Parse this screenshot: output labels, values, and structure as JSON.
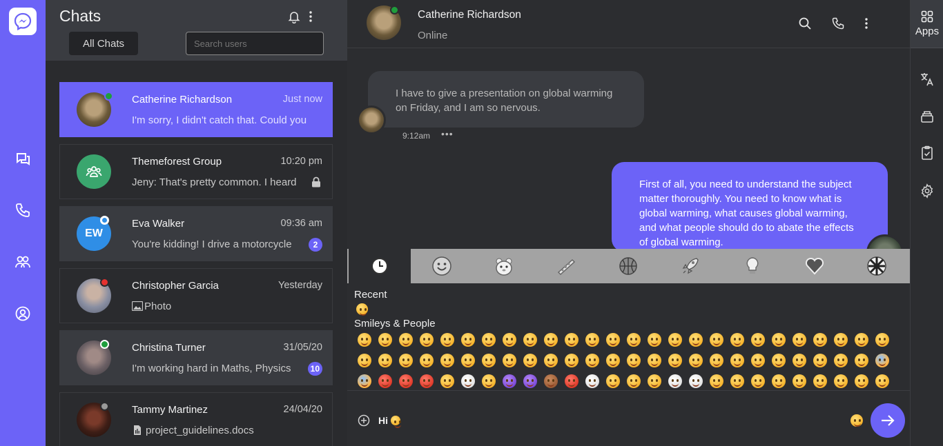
{
  "sidebar_list": {
    "title": "Chats",
    "all_chats_label": "All Chats",
    "search_placeholder": "Search users"
  },
  "chats": [
    {
      "name": "Catherine Richardson",
      "time": "Just now",
      "message": "I'm sorry, I didn't catch that. Could you",
      "status_color": "#1f9e3c",
      "avatar": "photo"
    },
    {
      "name": "Themeforest Group",
      "time": "10:20 pm",
      "message": "Jeny: That's pretty common. I heard",
      "avatar_color": "#3aa66e",
      "locked": true
    },
    {
      "name": "Eva Walker",
      "time": "09:36 am",
      "message": "You're kidding! I drive a motorcycle",
      "initials": "EW",
      "avatar_color": "#2f8ee6",
      "status_color": "#ffffff",
      "badge": "2"
    },
    {
      "name": "Christopher Garcia",
      "time": "Yesterday",
      "message": "Photo",
      "status_color": "#e5322f",
      "avatar": "photo"
    },
    {
      "name": "Christina Turner",
      "time": "31/05/20",
      "message": "I'm working hard in Maths, Physics",
      "status_color": "#1f9e3c",
      "badge": "10",
      "avatar": "photo"
    },
    {
      "name": "Tammy Martinez",
      "time": "24/04/20",
      "message": "project_guidelines.docs",
      "status_color": "#9a9a9a",
      "avatar": "photo"
    }
  ],
  "conversation": {
    "contact_name": "Catherine Richardson",
    "contact_status": "Online",
    "incoming": {
      "text": "I have to give a presentation on global warming on Friday, and I am so nervous.",
      "time": "9:12am",
      "more": "•••"
    },
    "outgoing": {
      "text": "First of all, you need to understand the subject matter thoroughly. You need to know what is global warming, what causes global warming, and what people should do to abate the effects of global warming."
    }
  },
  "emoji_picker": {
    "tabs": [
      "recent-icon",
      "smileys-icon",
      "animals-icon",
      "food-icon",
      "activities-icon",
      "travel-icon",
      "objects-icon",
      "symbols-icon",
      "flags-icon"
    ],
    "recent_label": "Recent",
    "smileys_label": "Smileys & People"
  },
  "composer": {
    "text": "Hi"
  },
  "right_rail": {
    "apps_label": "Apps"
  },
  "colors": {
    "accent": "#6c63f7",
    "online": "#1f9e3c",
    "busy": "#e5322f"
  }
}
